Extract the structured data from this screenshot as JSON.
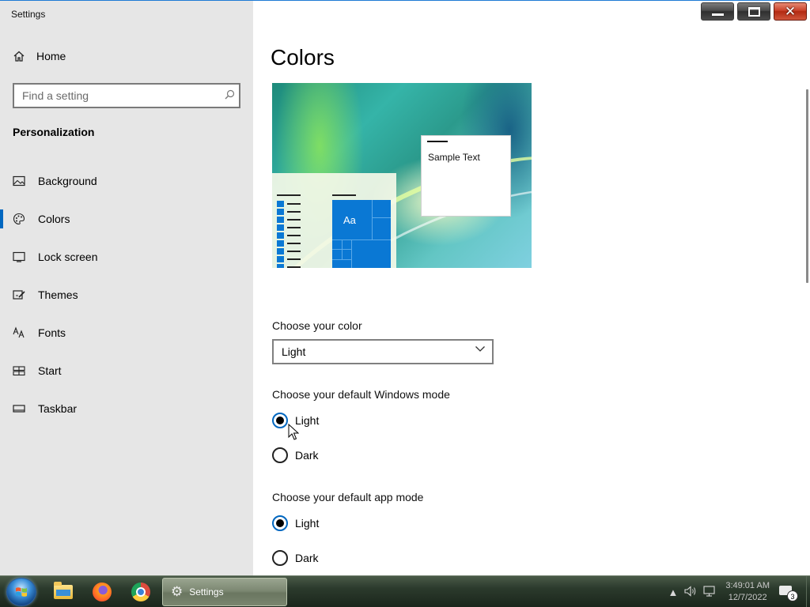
{
  "window": {
    "title": "Settings",
    "minimize_icon": "minimize-icon",
    "maximize_icon": "maximize-icon",
    "close_icon": "close-icon",
    "close_glyph": "✕"
  },
  "sidebar": {
    "home_label": "Home",
    "search_placeholder": "Find a setting",
    "section_title": "Personalization",
    "items": [
      {
        "label": "Background",
        "icon": "picture-icon",
        "active": false
      },
      {
        "label": "Colors",
        "icon": "palette-icon",
        "active": true
      },
      {
        "label": "Lock screen",
        "icon": "lock-screen-icon",
        "active": false
      },
      {
        "label": "Themes",
        "icon": "brush-icon",
        "active": false
      },
      {
        "label": "Fonts",
        "icon": "font-icon",
        "active": false
      },
      {
        "label": "Start",
        "icon": "start-icon",
        "active": false
      },
      {
        "label": "Taskbar",
        "icon": "taskbar-icon",
        "active": false
      }
    ]
  },
  "main": {
    "title": "Colors",
    "preview": {
      "sample_text": "Sample Text",
      "tile_text": "Aa"
    },
    "choose_color": {
      "label": "Choose your color",
      "selected": "Light"
    },
    "windows_mode": {
      "label": "Choose your default Windows mode",
      "options": [
        {
          "label": "Light",
          "checked": true
        },
        {
          "label": "Dark",
          "checked": false
        }
      ]
    },
    "app_mode": {
      "label": "Choose your default app mode",
      "options": [
        {
          "label": "Light",
          "checked": true
        },
        {
          "label": "Dark",
          "checked": false
        }
      ]
    }
  },
  "taskbar": {
    "settings_label": "Settings",
    "clock_time": "3:49:01 AM",
    "clock_date": "12/7/2022",
    "notification_count": "3"
  },
  "colors": {
    "accent": "#0067c0",
    "tile_blue": "#0a78d4",
    "sidebar_bg": "#e6e6e6"
  }
}
